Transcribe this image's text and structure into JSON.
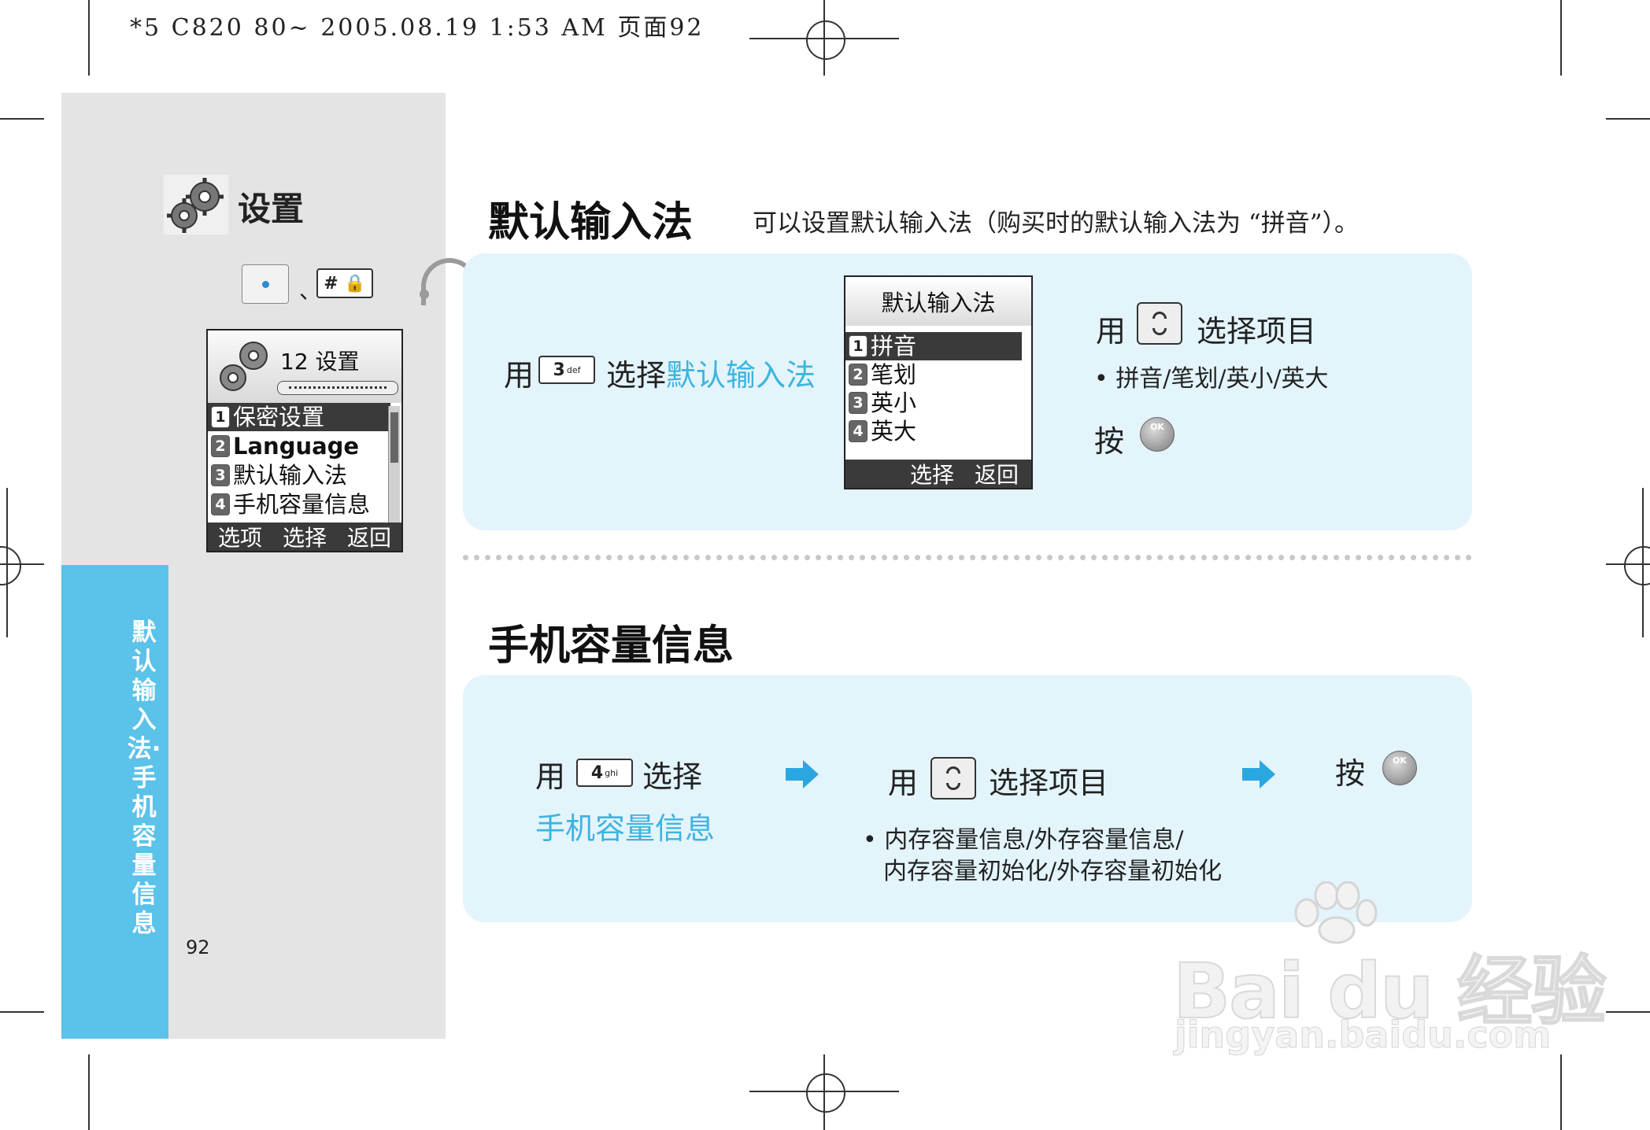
{
  "print_header": "*5 C820 80~ 2005.08.19 1:53 AM 页面92",
  "sidebar": {
    "section_title": "设置",
    "key_separator": "、",
    "hash_key_label": "# 🔒",
    "tab_text": "默认输入法·手机容量信息",
    "page_number": "92"
  },
  "menu_screen": {
    "title": "12 设置",
    "items": [
      {
        "num": "1",
        "label": "保密设置"
      },
      {
        "num": "2",
        "label": "Language"
      },
      {
        "num": "3",
        "label": "默认输入法"
      },
      {
        "num": "4",
        "label": "手机容量信息"
      }
    ],
    "softkeys": [
      "选项",
      "选择",
      "返回"
    ]
  },
  "section1": {
    "title": "默认输入法",
    "description": "可以设置默认输入法（购买时的默认输入法为 “拼音”）。",
    "step1_prefix": "用",
    "step1_key": "3",
    "step1_key_sub": "def",
    "step1_select": "选择",
    "step1_target": "默认输入法",
    "screen": {
      "title": "默认输入法",
      "items": [
        {
          "num": "1",
          "label": "拼音"
        },
        {
          "num": "2",
          "label": "笔划"
        },
        {
          "num": "3",
          "label": "英小"
        },
        {
          "num": "4",
          "label": "英大"
        }
      ],
      "softkeys": [
        "选择",
        "返回"
      ]
    },
    "step2_prefix": "用",
    "step2_text": "选择项目",
    "step2_options": "• 拼音/笔划/英小/英大",
    "step3_text": "按",
    "ok_label": "OK"
  },
  "section2": {
    "title": "手机容量信息",
    "step1_prefix": "用",
    "step1_key": "4",
    "step1_key_sub": "ghi",
    "step1_select": "选择",
    "step1_target": "手机容量信息",
    "step2_prefix": "用",
    "step2_text": "选择项目",
    "options_line1": "• 内存容量信息/外存容量信息/",
    "options_line2": "内存容量初始化/外存容量初始化",
    "step3_text": "按",
    "ok_label": "OK"
  },
  "watermark": {
    "brand": "Bai du 经验",
    "url": "jingyan.baidu.com"
  },
  "colors": {
    "accent_blue": "#5bc2ea",
    "highlight_text": "#3db4e0",
    "panel_bg": "#e3f4fb",
    "sidebar_bg": "#e4e4e4"
  }
}
